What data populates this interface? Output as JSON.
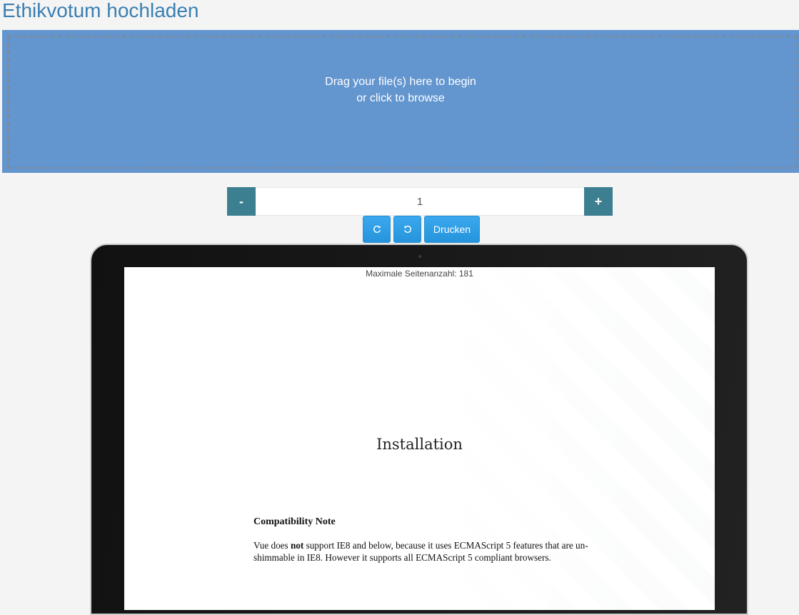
{
  "page": {
    "title": "Ethikvotum hochladen"
  },
  "dropzone": {
    "line1": "Drag your file(s) here to begin",
    "line2": "or click to browse",
    "background_color": "#6395cf"
  },
  "pager": {
    "decrement_label": "-",
    "increment_label": "+",
    "value": "1",
    "button_color": "#3c7f90"
  },
  "toolbar": {
    "rotate_cw_icon": "rotate-clockwise-icon",
    "rotate_ccw_icon": "rotate-counterclockwise-icon",
    "print_label": "Drucken",
    "button_color": "#2e9ee6"
  },
  "viewer": {
    "max_pages_text": "Maximale Seitenanzahl: 181",
    "document": {
      "heading": "Installation",
      "subheading": "Compatibility Note",
      "paragraph_before_bold": "Vue does ",
      "paragraph_bold": "not",
      "paragraph_after_bold": " support IE8 and below, because it uses ECMAScript 5 features that are un-shimmable in IE8. However it supports all ECMAScript 5 compliant browsers."
    }
  }
}
